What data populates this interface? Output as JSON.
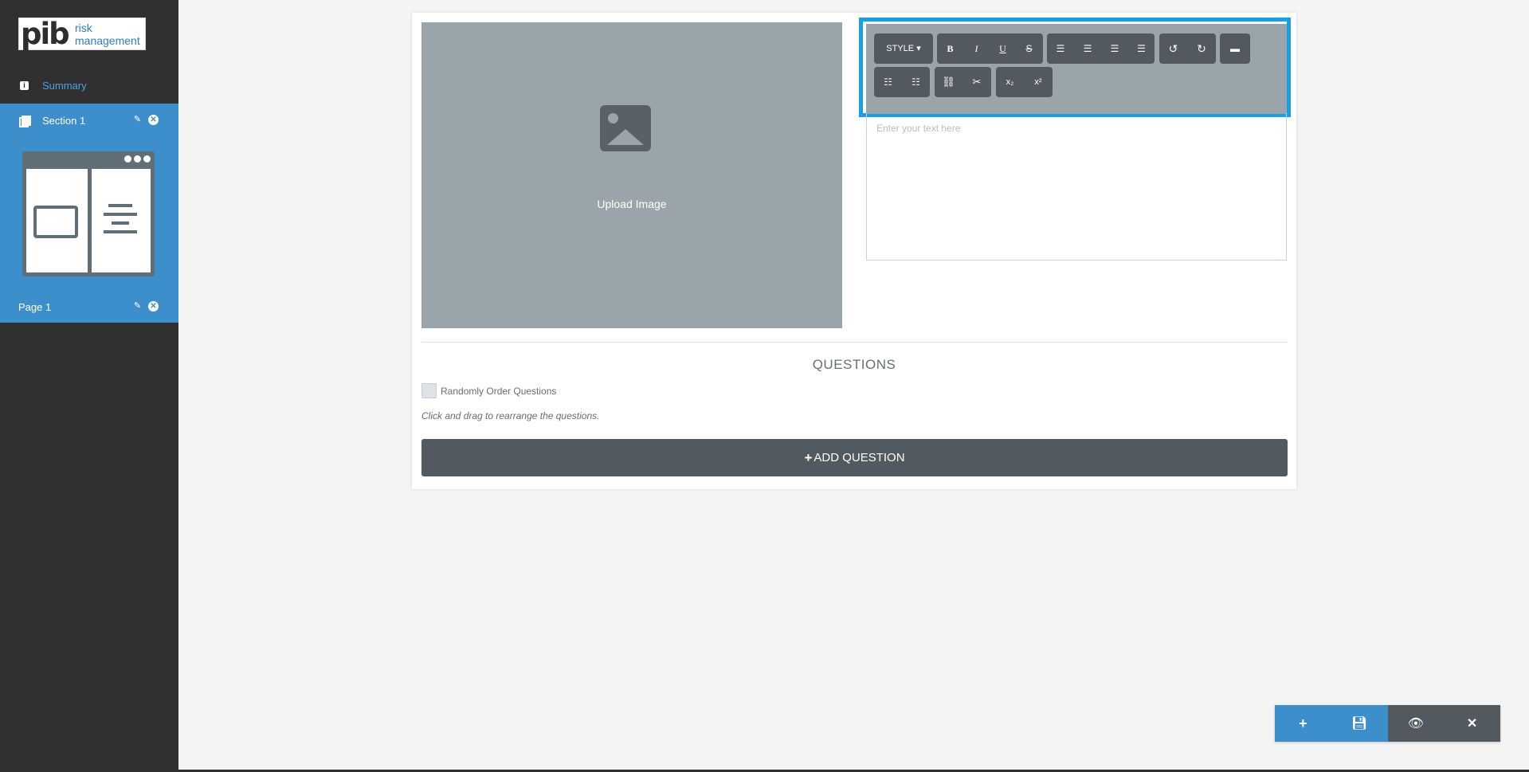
{
  "sidebar": {
    "logo": {
      "mark": "pib",
      "line1": "risk",
      "line2": "management"
    },
    "summary_label": "Summary",
    "section": {
      "label": "Section 1"
    },
    "page": {
      "label": "Page 1"
    }
  },
  "main": {
    "upload_label": "Upload Image",
    "toolbar": {
      "style_label": "STYLE",
      "bold": "B",
      "italic": "I",
      "underline": "U",
      "strike": "S",
      "subscript": "x₂",
      "superscript": "x²"
    },
    "editor_placeholder": "Enter your text here",
    "questions_title": "QUESTIONS",
    "random_order_label": "Randomly Order Questions",
    "drag_hint": "Click and drag to rearrange the questions.",
    "add_question_label": "ADD QUESTION"
  },
  "icons": {
    "summary": "info-icon",
    "section": "copy-icon",
    "edit": "edit-icon",
    "remove": "close-circle-icon",
    "upload": "image-icon",
    "fab": [
      "plus-icon",
      "save-icon",
      "eye-icon",
      "close-icon"
    ]
  },
  "colors": {
    "accent": "#3d8fcc",
    "highlight": "#1a9fe0",
    "sidebar": "#303030",
    "dark_button": "#52595f"
  }
}
